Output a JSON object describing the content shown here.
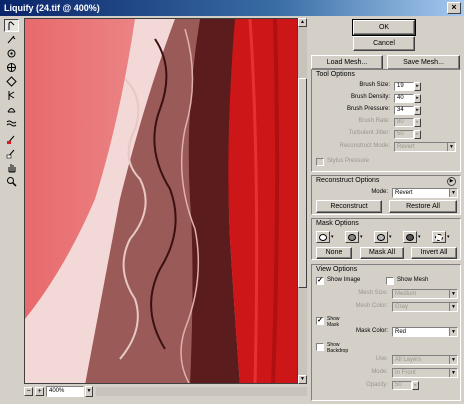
{
  "window": {
    "title": "Liquify (24.tif @ 400%)",
    "close_glyph": "×"
  },
  "toolbar": {
    "tools": [
      "forward-warp",
      "reconstruct",
      "twirl-clockwise",
      "pucker",
      "bloat",
      "push-left",
      "mirror",
      "turbulence",
      "freeze-mask",
      "thaw-mask",
      "hand",
      "zoom"
    ]
  },
  "status": {
    "zoom_out": "−",
    "zoom_in": "+",
    "zoom_value": "400%"
  },
  "buttons": {
    "ok": "OK",
    "cancel": "Cancel",
    "load_mesh": "Load Mesh...",
    "save_mesh": "Save Mesh..."
  },
  "tool_options": {
    "heading": "Tool Options",
    "brush_size": {
      "label": "Brush Size:",
      "value": "19"
    },
    "brush_density": {
      "label": "Brush Density:",
      "value": "40"
    },
    "brush_pressure": {
      "label": "Brush Pressure:",
      "value": "34"
    },
    "brush_rate": {
      "label": "Brush Rate:",
      "value": "80"
    },
    "turbulent_jitter": {
      "label": "Turbulent Jitter:",
      "value": "50"
    },
    "reconstruct_mode": {
      "label": "Reconstruct Mode:",
      "value": "Revert"
    },
    "stylus_pressure": "Stylus Pressure"
  },
  "reconstruct_options": {
    "heading": "Reconstruct Options",
    "mode_label": "Mode:",
    "mode_value": "Revert",
    "reconstruct": "Reconstruct",
    "restore_all": "Restore All"
  },
  "mask_options": {
    "heading": "Mask Options",
    "none": "None",
    "mask_all": "Mask All",
    "invert_all": "Invert All"
  },
  "view_options": {
    "heading": "View Options",
    "show_image": "Show Image",
    "show_image_checked": true,
    "show_mesh": "Show Mesh",
    "show_mesh_checked": false,
    "mesh_size": {
      "label": "Mesh Size:",
      "value": "Medium"
    },
    "mesh_color": {
      "label": "Mesh Color:",
      "value": "Gray"
    },
    "show_mask": "Show Mask",
    "show_mask_checked": true,
    "mask_color": {
      "label": "Mask Color:",
      "value": "Red"
    },
    "show_backdrop": "Show Backdrop",
    "show_backdrop_checked": false,
    "use": {
      "label": "Use:",
      "value": "All Layers"
    },
    "mode": {
      "label": "Mode:",
      "value": "In Front"
    },
    "opacity": {
      "label": "Opacity:",
      "value": "50"
    }
  },
  "colors": {
    "mask_red": "#d8181c",
    "title_blue": "#0a246a"
  }
}
